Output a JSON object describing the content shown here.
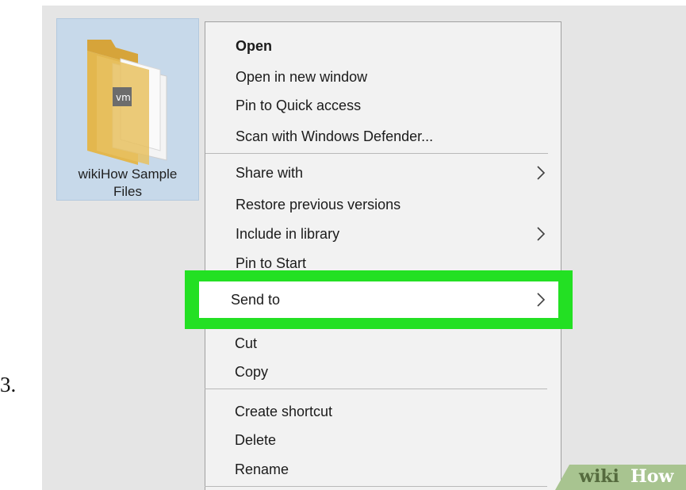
{
  "step_number": "3.",
  "folder": {
    "icon": "folder-icon",
    "name_line1": "wikiHow Sample",
    "name_line2": "Files",
    "badge_text": "vm"
  },
  "context_menu": {
    "group1": [
      {
        "label": "Open",
        "bold": true
      },
      {
        "label": "Open in new window"
      },
      {
        "label": "Pin to Quick access"
      },
      {
        "label": "Scan with Windows Defender..."
      }
    ],
    "group2": [
      {
        "label": "Share with",
        "submenu": true
      },
      {
        "label": "Restore previous versions"
      },
      {
        "label": "Include in library",
        "submenu": true
      },
      {
        "label": "Pin to Start"
      },
      {
        "label": "Send to",
        "submenu": true,
        "highlighted": true
      },
      {
        "label": "Cut"
      },
      {
        "label": "Copy"
      }
    ],
    "group3": [
      {
        "label": "Create shortcut"
      },
      {
        "label": "Delete"
      },
      {
        "label": "Rename"
      }
    ]
  },
  "highlight_color": "#23e023",
  "watermark": {
    "part1": "wiki",
    "part2": "How"
  }
}
